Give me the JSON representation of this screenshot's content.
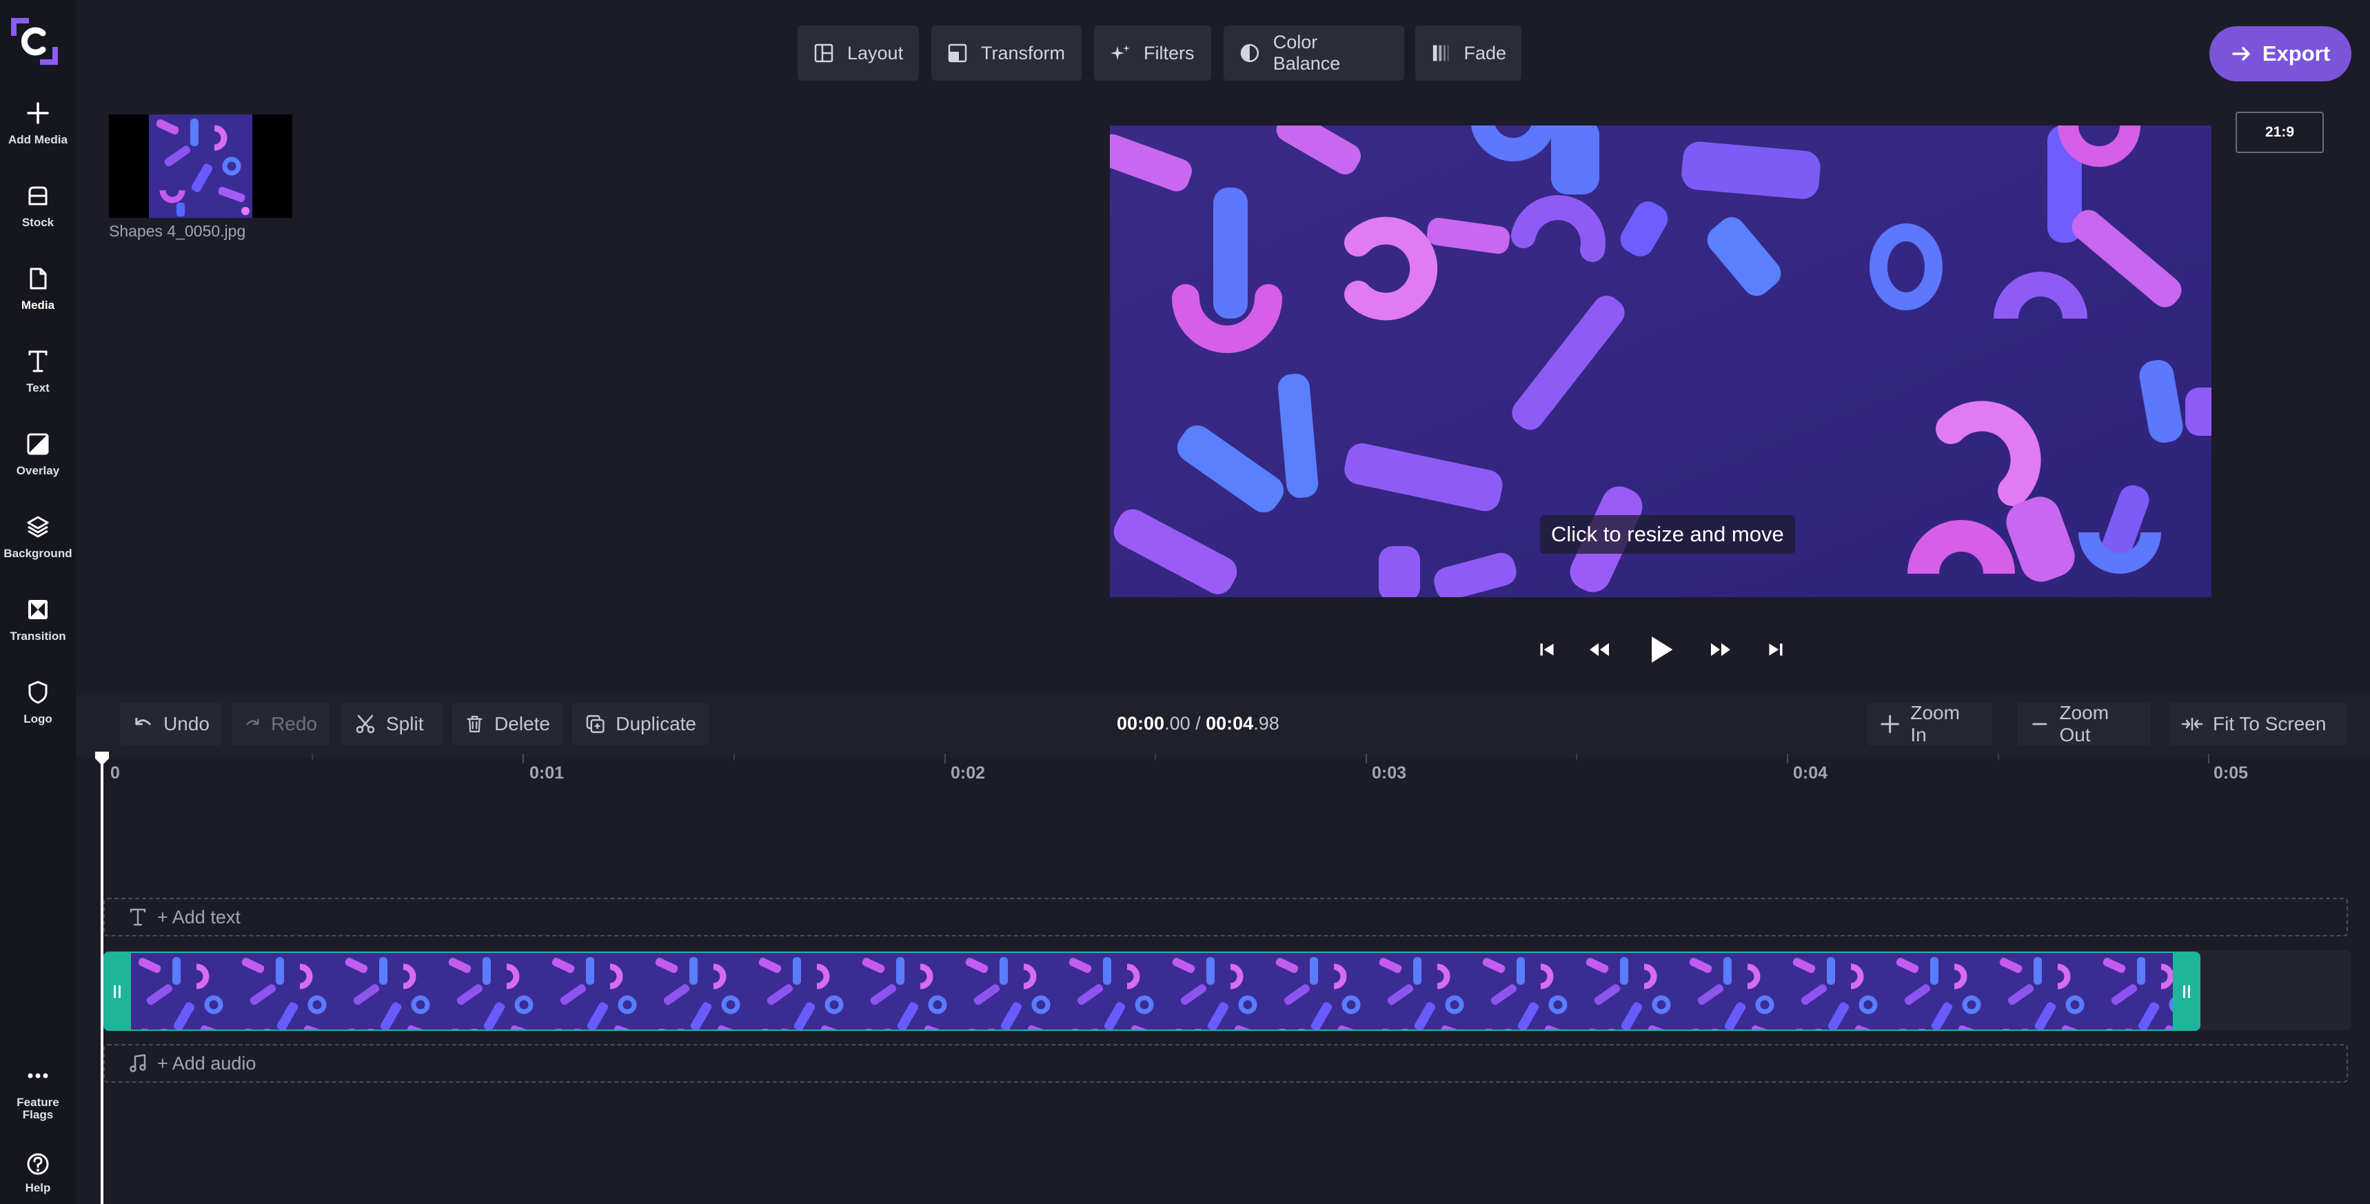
{
  "sidebar": {
    "items": [
      {
        "label": "Add Media",
        "icon": "plus-icon"
      },
      {
        "label": "Stock",
        "icon": "stock-icon"
      },
      {
        "label": "Media",
        "icon": "file-icon"
      },
      {
        "label": "Text",
        "icon": "text-icon"
      },
      {
        "label": "Overlay",
        "icon": "overlay-icon"
      },
      {
        "label": "Background",
        "icon": "layers-icon"
      },
      {
        "label": "Transition",
        "icon": "transition-icon"
      },
      {
        "label": "Logo",
        "icon": "shield-icon"
      }
    ],
    "feature_flags": "Feature Flags",
    "help": "Help"
  },
  "toolbar": {
    "layout": "Layout",
    "transform": "Transform",
    "filters": "Filters",
    "color_balance": "Color Balance",
    "fade": "Fade",
    "export": "Export"
  },
  "preview": {
    "aspect_ratio": "21:9",
    "hint": "Click to resize and move"
  },
  "media": {
    "file_name": "Shapes 4_0050.jpg"
  },
  "timeline": {
    "undo": "Undo",
    "redo": "Redo",
    "split": "Split",
    "delete": "Delete",
    "duplicate": "Duplicate",
    "current_time_main": "00:00",
    "current_time_frac": ".00",
    "separator": " / ",
    "total_time_main": "00:04",
    "total_time_frac": ".98",
    "zoom_in": "Zoom In",
    "zoom_out": "Zoom Out",
    "fit_to_screen": "Fit To Screen",
    "ruler": [
      "0",
      "0:01",
      "0:02",
      "0:03",
      "0:04",
      "0:05"
    ],
    "add_text": "+ Add text",
    "add_audio": "+ Add audio"
  },
  "colors": {
    "accent": "#7b55d9",
    "clip_border": "#1fb59a",
    "background": "#1b1c27"
  }
}
